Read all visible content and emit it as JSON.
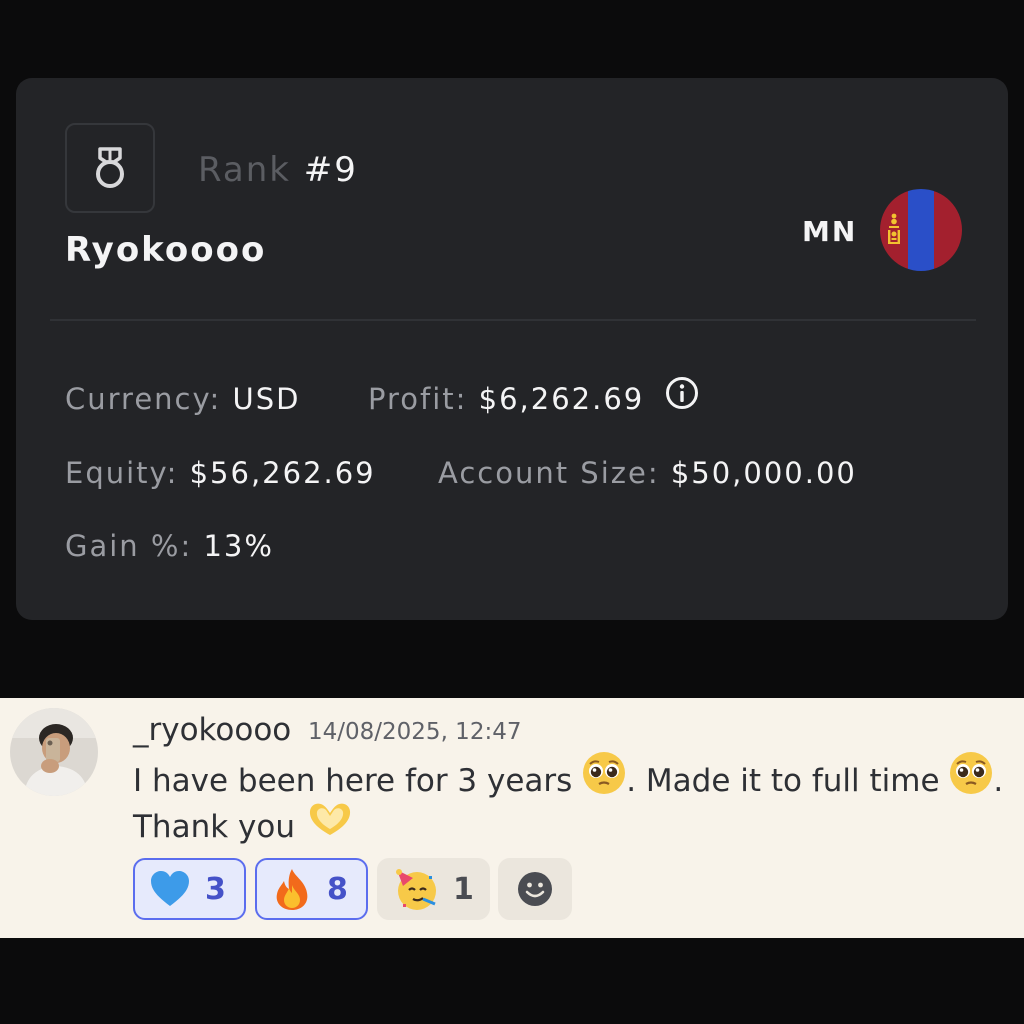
{
  "rank_card": {
    "rank_label": "Rank",
    "rank_value": "#9",
    "username": "Ryokoooo",
    "country_code": "MN",
    "flag_icon": "mongolia-flag-icon",
    "medal_icon": "medal-icon",
    "stats": {
      "currency": {
        "label": "Currency:",
        "value": "USD"
      },
      "profit": {
        "label": "Profit:",
        "value": "$6,262.69"
      },
      "equity": {
        "label": "Equity:",
        "value": "$56,262.69"
      },
      "account_size": {
        "label": "Account Size:",
        "value": "$50,000.00"
      },
      "gain": {
        "label": "Gain %:",
        "value": "13%"
      }
    }
  },
  "message": {
    "author": "_ryokoooo",
    "timestamp": "14/08/2025, 12:47",
    "line1_a": "I have been here for 3 years",
    "line1_b": ". Made it to full time",
    "line1_c": ".",
    "line2": "Thank you",
    "reactions": [
      {
        "emoji": "blue-heart-icon",
        "count": "3",
        "active": true
      },
      {
        "emoji": "fire-icon",
        "count": "8",
        "active": true
      },
      {
        "emoji": "partying-face-icon",
        "count": "1",
        "active": false
      }
    ],
    "add_reaction_icon": "smiley-icon"
  },
  "colors": {
    "page_bg": "#0b0b0c",
    "card_bg": "#232427",
    "chat_bg": "#f8f3ea",
    "reaction_active_border": "#5b6dee",
    "flag_red": "#a3202e",
    "flag_blue": "#2a4fc8"
  }
}
